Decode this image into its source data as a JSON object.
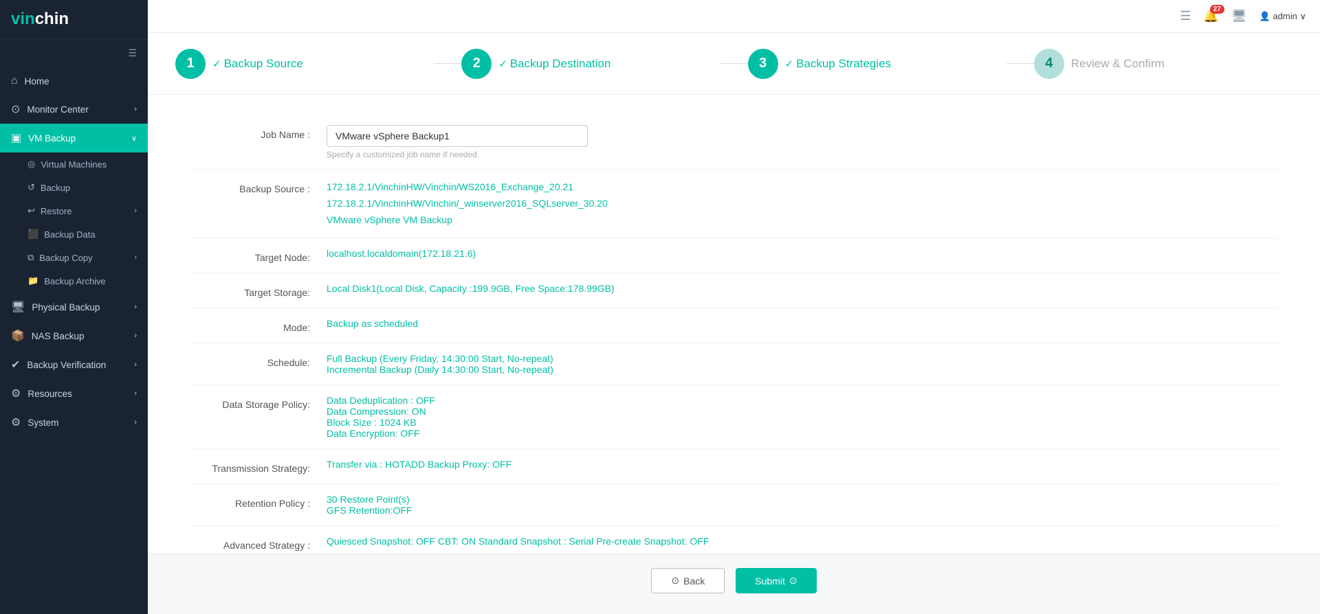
{
  "logo": {
    "vin": "vin",
    "chin": "chin"
  },
  "topbar": {
    "notification_count": "27",
    "admin_label": "admin"
  },
  "sidebar": {
    "hamburger": "☰",
    "items": [
      {
        "id": "home",
        "icon": "⌂",
        "label": "Home",
        "active": false
      },
      {
        "id": "monitor",
        "icon": "⊙",
        "label": "Monitor Center",
        "active": false,
        "arrow": "›"
      },
      {
        "id": "vm-backup",
        "icon": "▣",
        "label": "VM Backup",
        "active": true,
        "arrow": "∨",
        "subitems": [
          {
            "id": "virtual-machines",
            "icon": "◎",
            "label": "Virtual Machines"
          },
          {
            "id": "backup",
            "icon": "↺",
            "label": "Backup"
          },
          {
            "id": "restore",
            "icon": "↩",
            "label": "Restore",
            "arrow": "›"
          },
          {
            "id": "backup-data",
            "icon": "⬛",
            "label": "Backup Data"
          },
          {
            "id": "backup-copy",
            "icon": "⧉",
            "label": "Backup Copy",
            "arrow": "›"
          },
          {
            "id": "backup-archive",
            "icon": "📁",
            "label": "Backup Archive"
          }
        ]
      },
      {
        "id": "physical-backup",
        "icon": "🖥",
        "label": "Physical Backup",
        "active": false,
        "arrow": "›"
      },
      {
        "id": "nas-backup",
        "icon": "📦",
        "label": "NAS Backup",
        "active": false,
        "arrow": "›"
      },
      {
        "id": "backup-verification",
        "icon": "✔",
        "label": "Backup Verification",
        "active": false,
        "arrow": "›"
      },
      {
        "id": "resources",
        "icon": "⚙",
        "label": "Resources",
        "active": false,
        "arrow": "›"
      },
      {
        "id": "system",
        "icon": "⚙",
        "label": "System",
        "active": false,
        "arrow": "›"
      }
    ]
  },
  "steps": [
    {
      "id": "backup-source",
      "number": "1",
      "label": "Backup Source",
      "status": "done",
      "check": "✓"
    },
    {
      "id": "backup-destination",
      "number": "2",
      "label": "Backup Destination",
      "status": "done",
      "check": "✓"
    },
    {
      "id": "backup-strategies",
      "number": "3",
      "label": "Backup Strategies",
      "status": "done",
      "check": "✓"
    },
    {
      "id": "review-confirm",
      "number": "4",
      "label": "Review & Confirm",
      "status": "current"
    }
  ],
  "form": {
    "job_name_label": "Job Name :",
    "job_name_value": "VMware vSphere Backup1",
    "job_name_hint": "Specify a customized job name if needed.",
    "backup_source_label": "Backup Source :",
    "backup_source_lines": [
      "172.18.2.1/VinchinHW/Vinchin/WS2016_Exchange_20.21",
      "172.18.2.1/VinchinHW/Vinchin/_winserver2016_SQLserver_30.20",
      "VMware vSphere VM Backup"
    ],
    "target_node_label": "Target Node:",
    "target_node_value": "localhost.localdomain(172.18.21.6)",
    "target_storage_label": "Target Storage:",
    "target_storage_value": "Local Disk1(Local Disk, Capacity :199.9GB, Free Space:178.99GB)",
    "mode_label": "Mode:",
    "mode_value": "Backup as scheduled",
    "schedule_label": "Schedule:",
    "schedule_lines": [
      "Full Backup (Every Friday, 14:30:00 Start, No-repeat)",
      "Incremental Backup (Daily 14:30:00 Start, No-repeat)"
    ],
    "data_storage_policy_label": "Data Storage Policy:",
    "data_storage_policy_lines": [
      "Data Deduplication : OFF",
      "Data Compression: ON",
      "Block Size : 1024 KB",
      "Data Encryption: OFF"
    ],
    "transmission_strategy_label": "Transmission Strategy:",
    "transmission_strategy_value": "Transfer via : HOTADD Backup Proxy: OFF",
    "retention_policy_label": "Retention Policy :",
    "retention_policy_lines": [
      "30 Restore Point(s)",
      "GFS Retention:OFF"
    ],
    "advanced_strategy_label": "Advanced Strategy :",
    "advanced_strategy_value": "Quiesced Snapshot: OFF CBT: ON Standard Snapshot : Serial Pre-create Snapshot: OFF"
  },
  "actions": {
    "back_label": "Back",
    "back_icon": "⊙",
    "submit_label": "Submit",
    "submit_icon": "⊙"
  }
}
